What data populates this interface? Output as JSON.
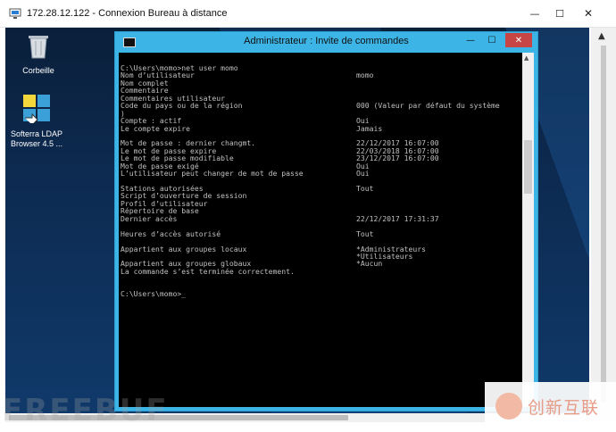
{
  "rdp": {
    "title": "172.28.12.122 - Connexion Bureau à distance",
    "minimize": "—",
    "maximize": "☐",
    "close": "✕"
  },
  "desktop": {
    "icons": [
      {
        "label": "Corbeille",
        "icon": "recycle-bin-icon"
      },
      {
        "label": "Softerra LDAP\nBrowser 4.5 ...",
        "icon": "ldap-browser-icon"
      }
    ]
  },
  "cmd": {
    "title": "Administrateur : Invite de commandes",
    "minimize": "—",
    "maximize": "☐",
    "close": "✕",
    "lines": [
      {
        "k": "C:\\Users\\momo>net user momo",
        "v": ""
      },
      {
        "k": "Nom d’utilisateur",
        "v": "momo"
      },
      {
        "k": "Nom complet",
        "v": ""
      },
      {
        "k": "Commentaire",
        "v": ""
      },
      {
        "k": "Commentaires utilisateur",
        "v": ""
      },
      {
        "k": "Code du pays ou de la région",
        "v": "000 (Valeur par défaut du système"
      },
      {
        "k": ")",
        "v": ""
      },
      {
        "k": "Compte : actif",
        "v": "Oui"
      },
      {
        "k": "Le compte expire",
        "v": "Jamais"
      },
      {
        "k": "",
        "v": ""
      },
      {
        "k": "Mot de passe : dernier changmt.",
        "v": "22/12/2017 16:07:00"
      },
      {
        "k": "Le mot de passe expire",
        "v": "22/03/2018 16:07:00"
      },
      {
        "k": "Le mot de passe modifiable",
        "v": "23/12/2017 16:07:00"
      },
      {
        "k": "Mot de passe exigé",
        "v": "Oui"
      },
      {
        "k": "L’utilisateur peut changer de mot de passe",
        "v": "Oui"
      },
      {
        "k": "",
        "v": ""
      },
      {
        "k": "Stations autorisées",
        "v": "Tout"
      },
      {
        "k": "Script d’ouverture de session",
        "v": ""
      },
      {
        "k": "Profil d’utilisateur",
        "v": ""
      },
      {
        "k": "Répertoire de base",
        "v": ""
      },
      {
        "k": "Dernier accès",
        "v": "22/12/2017 17:31:37"
      },
      {
        "k": "",
        "v": ""
      },
      {
        "k": "Heures d’accès autorisé",
        "v": "Tout"
      },
      {
        "k": "",
        "v": ""
      },
      {
        "k": "Appartient aux groupes locaux",
        "v": "*Administrateurs"
      },
      {
        "k": "",
        "v": "*Utilisateurs"
      },
      {
        "k": "Appartient aux groupes globaux",
        "v": "*Aucun"
      },
      {
        "k": "La commande s’est terminée correctement.",
        "v": ""
      },
      {
        "k": "",
        "v": ""
      },
      {
        "k": "",
        "v": ""
      },
      {
        "k": "C:\\Users\\momo>_",
        "v": ""
      }
    ]
  },
  "watermarks": {
    "left": "FREEBUF",
    "brand": "创新互联"
  }
}
